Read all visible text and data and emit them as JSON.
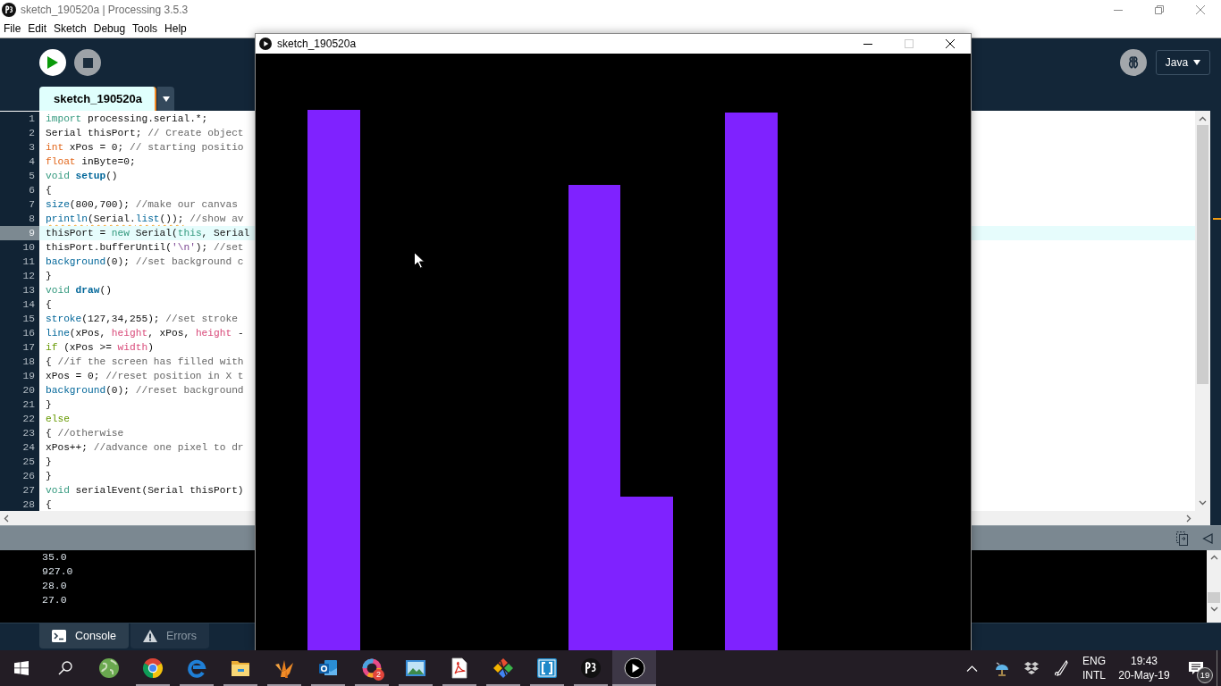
{
  "ide_window": {
    "title": "sketch_190520a | Processing 3.5.3",
    "menu": [
      "File",
      "Edit",
      "Sketch",
      "Debug",
      "Tools",
      "Help"
    ],
    "mode": "Java",
    "tabs": [
      {
        "label": "sketch_190520a",
        "selected": true
      }
    ],
    "editor": {
      "lines": [
        {
          "number": "1",
          "current": false,
          "warning": false,
          "tokens": [
            {
              "kind": "keyword",
              "text": "import"
            },
            {
              "kind": "plain",
              "text": " processing.serial.*;"
            }
          ]
        },
        {
          "number": "2",
          "current": false,
          "warning": false,
          "tokens": [
            {
              "kind": "plain",
              "text": "Serial thisPort; "
            },
            {
              "kind": "comment",
              "text": "// Create object"
            }
          ]
        },
        {
          "number": "3",
          "current": false,
          "warning": false,
          "tokens": [
            {
              "kind": "type",
              "text": "int"
            },
            {
              "kind": "plain",
              "text": " xPos = 0; "
            },
            {
              "kind": "comment",
              "text": "// starting positio"
            }
          ]
        },
        {
          "number": "4",
          "current": false,
          "warning": false,
          "tokens": [
            {
              "kind": "type",
              "text": "float"
            },
            {
              "kind": "plain",
              "text": " inByte=0;"
            }
          ]
        },
        {
          "number": "5",
          "current": false,
          "warning": false,
          "tokens": [
            {
              "kind": "keyword",
              "text": "void "
            },
            {
              "kind": "function_bold",
              "text": "setup"
            },
            {
              "kind": "plain",
              "text": "()"
            }
          ]
        },
        {
          "number": "6",
          "current": false,
          "warning": false,
          "tokens": [
            {
              "kind": "plain",
              "text": "{"
            }
          ]
        },
        {
          "number": "7",
          "current": false,
          "warning": false,
          "tokens": [
            {
              "kind": "function",
              "text": "size"
            },
            {
              "kind": "plain",
              "text": "(800,700); "
            },
            {
              "kind": "comment",
              "text": "//make our canvas"
            }
          ]
        },
        {
          "number": "8",
          "current": false,
          "warning": true,
          "tokens": [
            {
              "kind": "function",
              "text": "println"
            },
            {
              "kind": "plain",
              "text": "(Serial."
            },
            {
              "kind": "function",
              "text": "list"
            },
            {
              "kind": "plain",
              "text": "());"
            },
            {
              "kind": "comment",
              "text": " //show av"
            }
          ]
        },
        {
          "number": "9",
          "current": true,
          "warning": false,
          "tokens": [
            {
              "kind": "plain",
              "text": "thisPort = "
            },
            {
              "kind": "keyword",
              "text": "new"
            },
            {
              "kind": "plain",
              "text": " Serial("
            },
            {
              "kind": "keyword",
              "text": "this"
            },
            {
              "kind": "plain",
              "text": ", Serial"
            }
          ]
        },
        {
          "number": "10",
          "current": false,
          "warning": false,
          "tokens": [
            {
              "kind": "plain",
              "text": "thisPort.bufferUntil("
            },
            {
              "kind": "string",
              "text": "'\\n'"
            },
            {
              "kind": "plain",
              "text": "); "
            },
            {
              "kind": "comment",
              "text": "//set"
            }
          ]
        },
        {
          "number": "11",
          "current": false,
          "warning": false,
          "tokens": [
            {
              "kind": "function",
              "text": "background"
            },
            {
              "kind": "plain",
              "text": "(0); "
            },
            {
              "kind": "comment",
              "text": "//set background c"
            }
          ]
        },
        {
          "number": "12",
          "current": false,
          "warning": false,
          "tokens": [
            {
              "kind": "plain",
              "text": "}"
            }
          ]
        },
        {
          "number": "13",
          "current": false,
          "warning": false,
          "tokens": [
            {
              "kind": "keyword",
              "text": "void "
            },
            {
              "kind": "function_bold",
              "text": "draw"
            },
            {
              "kind": "plain",
              "text": "()"
            }
          ]
        },
        {
          "number": "14",
          "current": false,
          "warning": false,
          "tokens": [
            {
              "kind": "plain",
              "text": "{"
            }
          ]
        },
        {
          "number": "15",
          "current": false,
          "warning": false,
          "tokens": [
            {
              "kind": "function",
              "text": "stroke"
            },
            {
              "kind": "plain",
              "text": "(127,34,255); "
            },
            {
              "kind": "comment",
              "text": "//set stroke"
            }
          ]
        },
        {
          "number": "16",
          "current": false,
          "warning": false,
          "tokens": [
            {
              "kind": "function",
              "text": "line"
            },
            {
              "kind": "plain",
              "text": "(xPos, "
            },
            {
              "kind": "constant",
              "text": "height"
            },
            {
              "kind": "plain",
              "text": ", xPos, "
            },
            {
              "kind": "constant",
              "text": "height"
            },
            {
              "kind": "plain",
              "text": " -"
            }
          ]
        },
        {
          "number": "17",
          "current": false,
          "warning": false,
          "tokens": [
            {
              "kind": "control",
              "text": "if"
            },
            {
              "kind": "plain",
              "text": " (xPos >= "
            },
            {
              "kind": "constant",
              "text": "width"
            },
            {
              "kind": "plain",
              "text": ")"
            }
          ]
        },
        {
          "number": "18",
          "current": false,
          "warning": false,
          "tokens": [
            {
              "kind": "plain",
              "text": "{ "
            },
            {
              "kind": "comment",
              "text": "//if the screen has filled with"
            }
          ]
        },
        {
          "number": "19",
          "current": false,
          "warning": false,
          "tokens": [
            {
              "kind": "plain",
              "text": "xPos = 0; "
            },
            {
              "kind": "comment",
              "text": "//reset position in X t"
            }
          ]
        },
        {
          "number": "20",
          "current": false,
          "warning": false,
          "tokens": [
            {
              "kind": "function",
              "text": "background"
            },
            {
              "kind": "plain",
              "text": "(0); "
            },
            {
              "kind": "comment",
              "text": "//reset background"
            }
          ]
        },
        {
          "number": "21",
          "current": false,
          "warning": false,
          "tokens": [
            {
              "kind": "plain",
              "text": "}"
            }
          ]
        },
        {
          "number": "22",
          "current": false,
          "warning": false,
          "tokens": [
            {
              "kind": "control",
              "text": "else"
            }
          ]
        },
        {
          "number": "23",
          "current": false,
          "warning": false,
          "tokens": [
            {
              "kind": "plain",
              "text": "{ "
            },
            {
              "kind": "comment",
              "text": "//otherwise"
            }
          ]
        },
        {
          "number": "24",
          "current": false,
          "warning": false,
          "tokens": [
            {
              "kind": "plain",
              "text": "xPos++; "
            },
            {
              "kind": "comment",
              "text": "//advance one pixel to dr"
            }
          ]
        },
        {
          "number": "25",
          "current": false,
          "warning": false,
          "tokens": [
            {
              "kind": "plain",
              "text": "}"
            }
          ]
        },
        {
          "number": "26",
          "current": false,
          "warning": false,
          "tokens": [
            {
              "kind": "plain",
              "text": "}"
            }
          ]
        },
        {
          "number": "27",
          "current": false,
          "warning": false,
          "tokens": [
            {
              "kind": "keyword",
              "text": "void"
            },
            {
              "kind": "plain",
              "text": " serialEvent(Serial thisPort)"
            }
          ]
        },
        {
          "number": "28",
          "current": false,
          "warning": false,
          "tokens": [
            {
              "kind": "plain",
              "text": "{"
            }
          ]
        }
      ]
    },
    "console": {
      "lines": [
        "35.0",
        "927.0",
        "28.0",
        "27.0"
      ]
    },
    "console_tabs": [
      {
        "kind": "console",
        "label": "Console",
        "selected": true
      },
      {
        "kind": "errors",
        "label": "Errors",
        "selected": false
      }
    ]
  },
  "sketch_window": {
    "title": "sketch_190520a",
    "maximize_disabled": true
  },
  "taskbar": {
    "apps": [
      {
        "kind": "globe",
        "running": false,
        "active": false
      },
      {
        "kind": "color-wheel",
        "running": true,
        "active": false
      },
      {
        "kind": "swirl",
        "running": true,
        "active": false
      },
      {
        "kind": "folder",
        "running": true,
        "active": false
      },
      {
        "kind": "bird",
        "running": true,
        "active": false
      },
      {
        "kind": "mail",
        "running": true,
        "active": false
      },
      {
        "kind": "ring",
        "running": true,
        "active": false,
        "badge": "2"
      },
      {
        "kind": "picture",
        "running": true,
        "active": false
      },
      {
        "kind": "document",
        "running": true,
        "active": false
      },
      {
        "kind": "diamond",
        "running": true,
        "active": false
      },
      {
        "kind": "bracket",
        "running": true,
        "active": false
      },
      {
        "kind": "round-logo",
        "running": true,
        "active": false
      },
      {
        "kind": "play",
        "running": true,
        "active": true
      }
    ],
    "tray": {
      "language": "ENG",
      "layout": "INTL",
      "time": "19:43",
      "date": "20-May-19",
      "notifications": "19"
    }
  }
}
